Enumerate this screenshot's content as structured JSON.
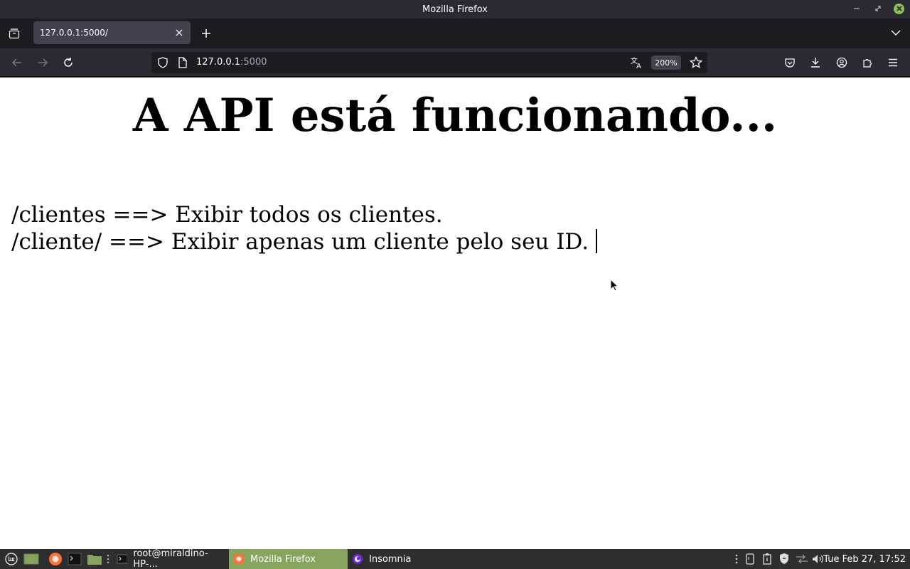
{
  "window": {
    "title": "Mozilla Firefox"
  },
  "tabs": [
    {
      "label": "127.0.0.1:5000/"
    }
  ],
  "urlbar": {
    "host": "127.0.0.1",
    "port": ":5000",
    "zoom": "200%"
  },
  "page": {
    "heading": "A API está funcionando...",
    "routes": [
      "/clientes ==> Exibir todos os clientes.",
      "/cliente/ ==> Exibir apenas um cliente pelo seu ID."
    ]
  },
  "taskbar": {
    "tasks": [
      {
        "label": "root@miraldino-HP-...",
        "icon": "terminal-icon"
      },
      {
        "label": "Mozilla Firefox",
        "icon": "firefox-icon",
        "active": true
      },
      {
        "label": "Insomnia",
        "icon": "insomnia-icon"
      }
    ],
    "clock": "Tue Feb 27, 17:52"
  },
  "colors": {
    "accent_green": "#86a45e",
    "chrome_dark": "#2b2a33",
    "tabstrip": "#1c1b22"
  }
}
